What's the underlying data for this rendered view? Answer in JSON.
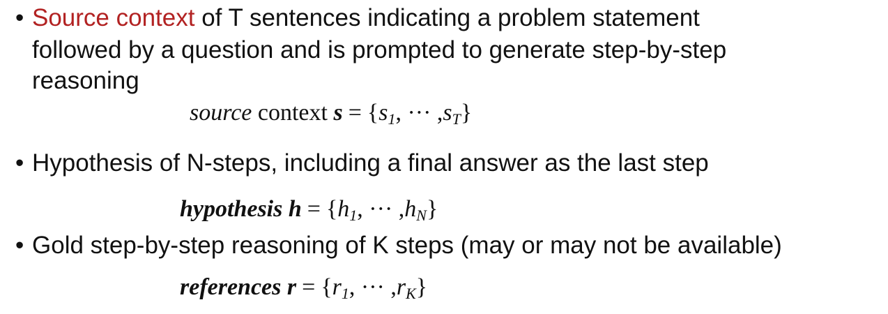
{
  "items": [
    {
      "accent": "Source context",
      "text1": "of T sentences indicating a problem statement",
      "text2": "followed by a question and is prompted to generate step-by-step",
      "text3": "reasoning",
      "formula": {
        "name": "source",
        "word": "context",
        "sym": "s",
        "a": "s",
        "b": "s",
        "sub1": "1",
        "subN": "T"
      }
    },
    {
      "text1": "Hypothesis of N-steps, including a final answer as the last step",
      "formula": {
        "name": "hypothesis",
        "sym": "h",
        "a": "h",
        "b": "h",
        "sub1": "1",
        "subN": "N"
      }
    },
    {
      "text1": "Gold step-by-step reasoning of K steps (may or may not be available)",
      "formula": {
        "name": "references",
        "sym": "r",
        "a": "r",
        "b": "r",
        "sub1": "1",
        "subN": "K"
      }
    }
  ],
  "symbols": {
    "bullet": "•",
    "eq": "=",
    "open": "{",
    "close": "}",
    "comma": ",",
    "dots": "···"
  },
  "colors": {
    "accent": "#b22222",
    "text": "#111111"
  }
}
